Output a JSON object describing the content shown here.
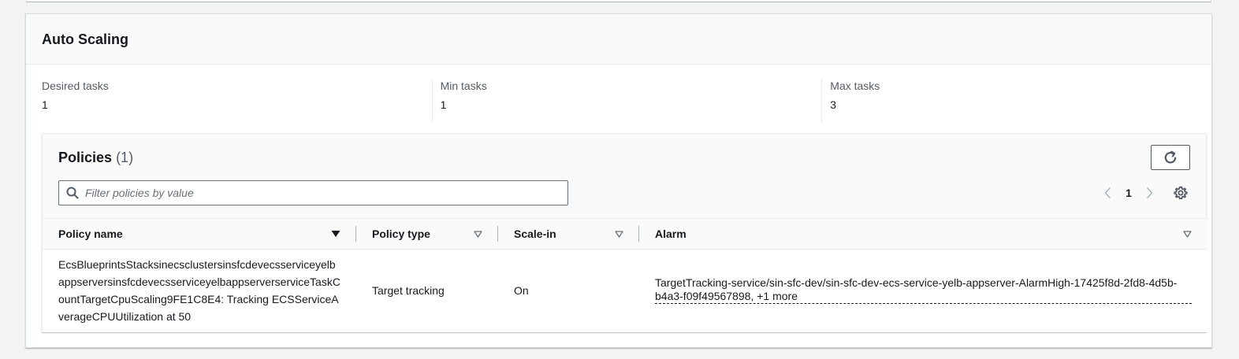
{
  "panel": {
    "title": "Auto Scaling"
  },
  "tasks": [
    {
      "label": "Desired tasks",
      "value": "1"
    },
    {
      "label": "Min tasks",
      "value": "1"
    },
    {
      "label": "Max tasks",
      "value": "3"
    }
  ],
  "policies": {
    "title": "Policies",
    "count": "(1)",
    "search_placeholder": "Filter policies by value",
    "page": "1",
    "columns": [
      "Policy name",
      "Policy type",
      "Scale-in",
      "Alarm"
    ],
    "rows": [
      {
        "name": "EcsBlueprintsStacksinecsclustersinsfcdevecsserviceyelbappserversinsfcdevecsserviceyelbappserverserviceTaskCountTargetCpuScaling9FE1C8E4: Tracking ECSServiceAverageCPUUtilization at 50",
        "type": "Target tracking",
        "scale_in": "On",
        "alarm": "TargetTracking-service/sin-sfc-dev/sin-sfc-dev-ecs-service-yelb-appserver-AlarmHigh-17425f8d-2fd8-4d5b-b4a3-f09f49567898, +1 more"
      }
    ]
  },
  "icons": {
    "refresh": "refresh-icon",
    "search": "search-icon",
    "prev": "chevron-left-icon",
    "next": "chevron-right-icon",
    "settings": "gear-icon",
    "sort_active": "caret-down-filled-icon",
    "sort": "caret-down-outline-icon"
  }
}
